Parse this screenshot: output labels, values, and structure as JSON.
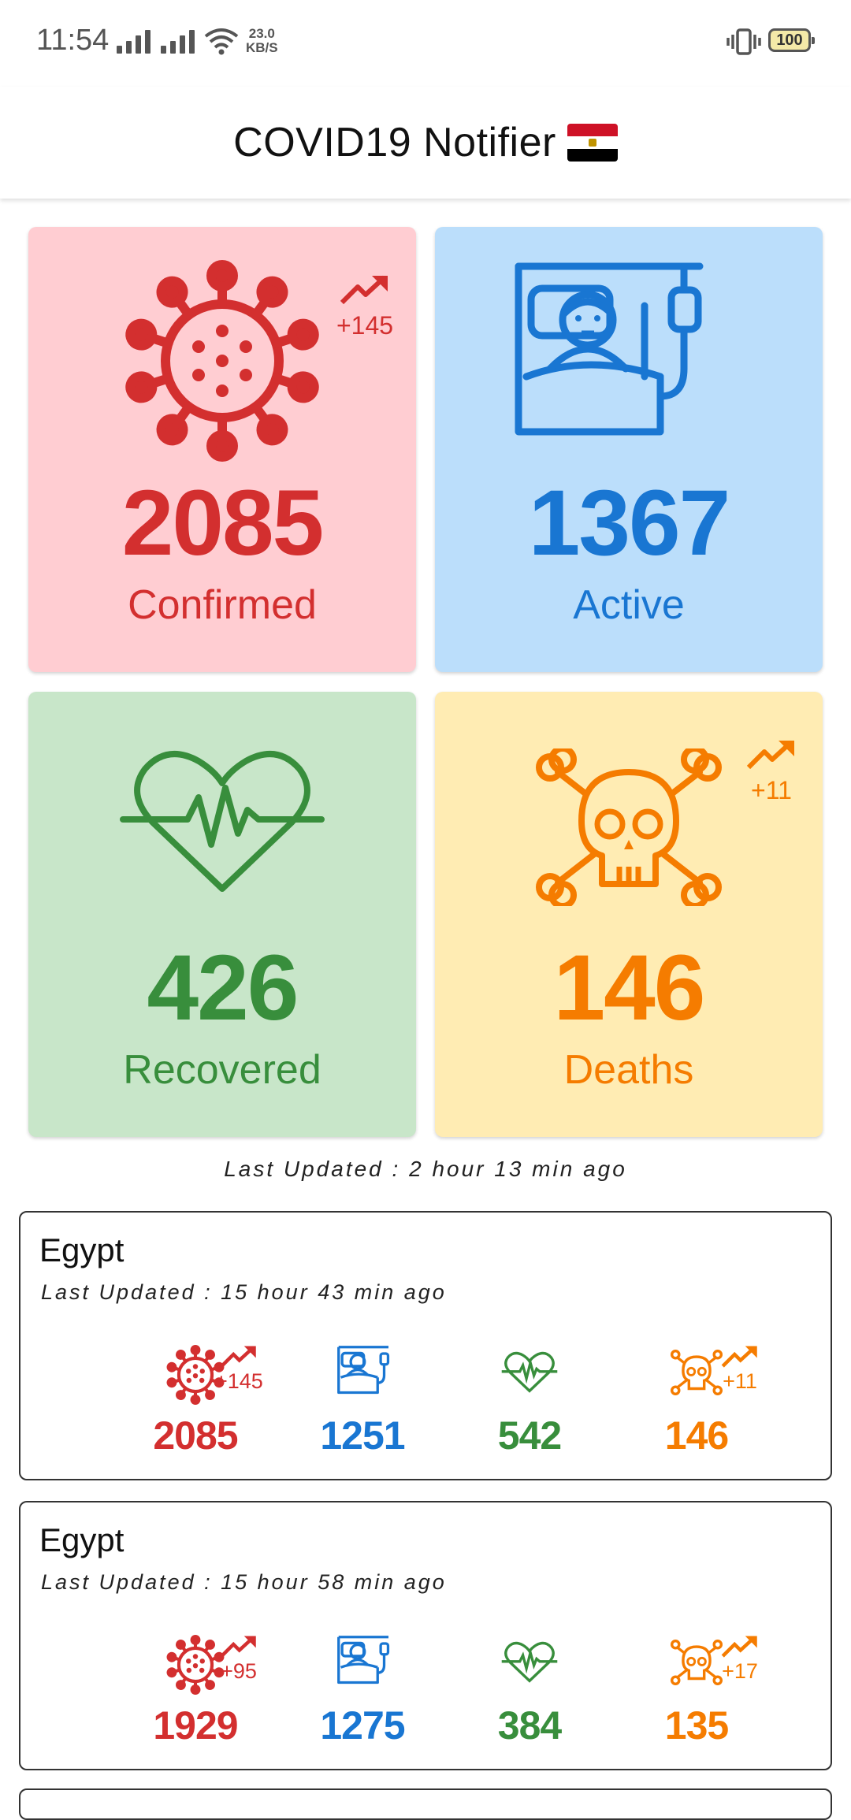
{
  "status_bar": {
    "time": "11:54",
    "speed_value": "23.0",
    "speed_unit": "KB/S",
    "battery": "100"
  },
  "app_bar": {
    "title": "COVID19 Notifier"
  },
  "colors": {
    "red": "#d32f2f",
    "blue": "#1976d2",
    "green": "#388e3c",
    "orange": "#f57c00"
  },
  "summary": {
    "confirmed": {
      "value": "2085",
      "label": "Confirmed",
      "delta": "+145",
      "icon": "virus-icon",
      "bg": "#ffcdd2"
    },
    "active": {
      "value": "1367",
      "label": "Active",
      "icon": "patient-bed-icon",
      "bg": "#bbdefb"
    },
    "recovered": {
      "value": "426",
      "label": "Recovered",
      "icon": "heartbeat-icon",
      "bg": "#c8e6c9"
    },
    "deaths": {
      "value": "146",
      "label": "Deaths",
      "delta": "+11",
      "icon": "skull-crossbones-icon",
      "bg": "#ffecb3"
    },
    "last_updated": "Last Updated : 2 hour 13 min ago"
  },
  "history": [
    {
      "country": "Egypt",
      "last_updated": "Last Updated : 15 hour 43 min ago",
      "confirmed": "2085",
      "confirmed_delta": "+145",
      "active": "1251",
      "recovered": "542",
      "deaths": "146",
      "deaths_delta": "+11"
    },
    {
      "country": "Egypt",
      "last_updated": "Last Updated : 15 hour 58 min ago",
      "confirmed": "1929",
      "confirmed_delta": "+95",
      "active": "1275",
      "recovered": "384",
      "deaths": "135",
      "deaths_delta": "+17"
    }
  ]
}
